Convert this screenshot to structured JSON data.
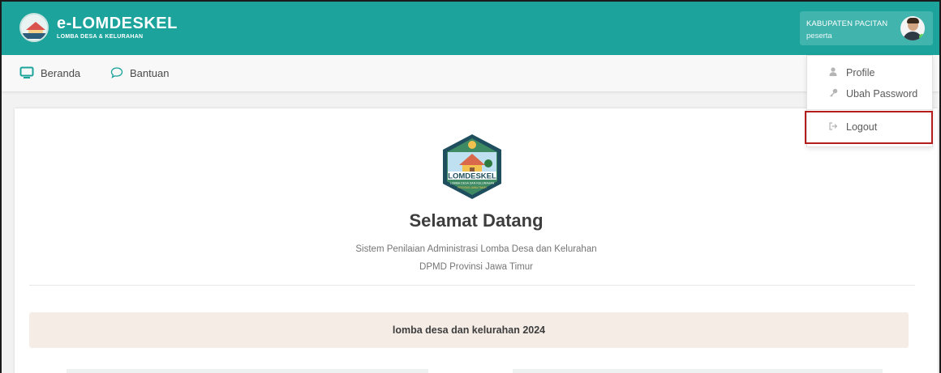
{
  "header": {
    "brand_title": "e-LOMDESKEL",
    "brand_subtitle": "LOMBA DESA & KELURAHAN",
    "user_name": "KABUPATEN PACITAN",
    "user_role": "peserta"
  },
  "nav": {
    "items": [
      {
        "label": "Beranda",
        "icon": "monitor-icon"
      },
      {
        "label": "Bantuan",
        "icon": "chat-bubble-icon"
      }
    ]
  },
  "dropdown": {
    "items": [
      {
        "label": "Profile",
        "icon": "user-icon"
      },
      {
        "label": "Ubah Password",
        "icon": "key-icon"
      },
      {
        "label": "Logout",
        "icon": "logout-icon"
      }
    ],
    "highlight_color": "#b51d1d"
  },
  "main": {
    "emblem_text": "LOMDESKEL",
    "emblem_subtext": "LOMBA DESA DAN KELURAHAN",
    "emblem_footer": "PROVINSI JAWA TIMUR",
    "title": "Selamat Datang",
    "subtitle_line1": "Sistem Penilaian Administrasi Lomba Desa dan Kelurahan",
    "subtitle_line2": "DPMD Provinsi Jawa Timur",
    "banner": "lomba desa dan kelurahan 2024"
  },
  "colors": {
    "primary": "#1ba39c",
    "banner_bg": "#f5ece6"
  }
}
